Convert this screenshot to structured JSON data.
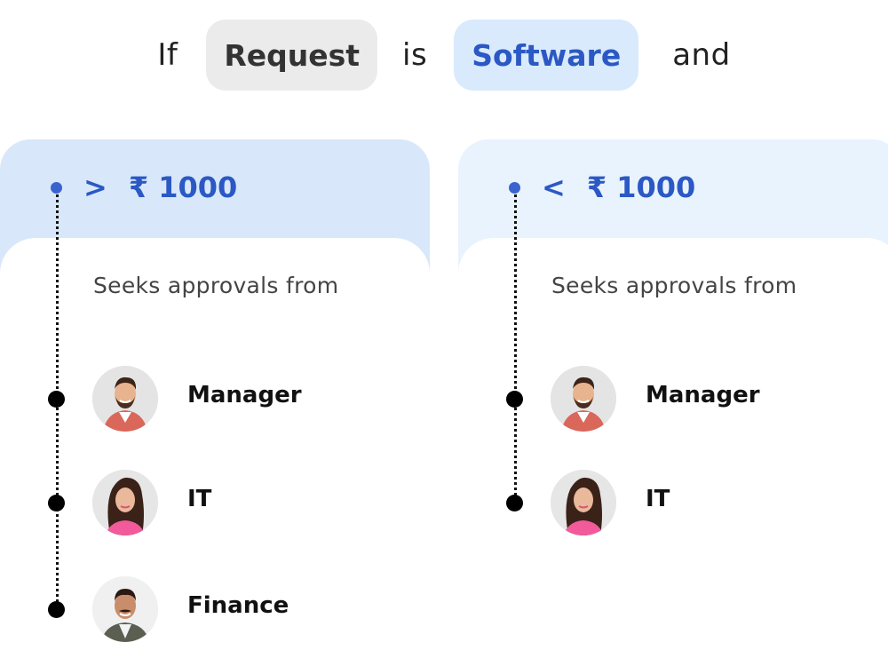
{
  "condition": {
    "prefix": "If",
    "field": "Request",
    "operator": "is",
    "value": "Software",
    "suffix": "and"
  },
  "rules": [
    {
      "operator": ">",
      "amount": "₹ 1000",
      "subtitle": "Seeks approvals from",
      "approvers": [
        {
          "role": "Manager",
          "avatar": "man-bearded-plaid-shirt"
        },
        {
          "role": "IT",
          "avatar": "woman-long-hair-pink-top"
        },
        {
          "role": "Finance",
          "avatar": "man-mustache-blazer"
        }
      ]
    },
    {
      "operator": "<",
      "amount": "₹ 1000",
      "subtitle": "Seeks approvals from",
      "approvers": [
        {
          "role": "Manager",
          "avatar": "man-bearded-plaid-shirt"
        },
        {
          "role": "IT",
          "avatar": "woman-long-hair-pink-top"
        }
      ]
    }
  ],
  "colors": {
    "accent": "#2b58c4",
    "chip_gray": "#ebebeb",
    "chip_blue": "#d9eafc",
    "card_left_header": "#d8e8fa",
    "card_right_header": "#e9f3fd"
  }
}
